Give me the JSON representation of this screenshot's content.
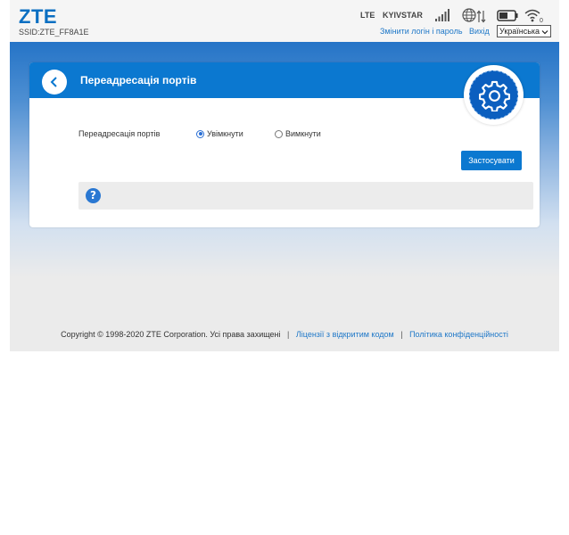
{
  "header": {
    "logo": "ZTE",
    "ssid": "SSID:ZTE_FF8A1E",
    "network_type": "LTE",
    "operator": "KYIVSTAR",
    "signal_bars": 5,
    "change_login_label": "Змінити логін і пароль",
    "logout_label": "Вихід",
    "language_selected": "Українська",
    "wifi_clients": "0"
  },
  "panel": {
    "title": "Переадресація портів",
    "field_label": "Переадресація портів",
    "option_on": "Увімкнути",
    "option_off": "Вимкнути",
    "selected": "on",
    "apply_label": "Застосувати",
    "help_symbol": "?"
  },
  "footer": {
    "copyright": "Copyright © 1998-2020 ZTE Corporation. Усі права захищені",
    "separator": "|",
    "license_link": "Ліцензії з відкритим кодом",
    "privacy_link": "Політика конфіденційності"
  },
  "colors": {
    "brand_blue": "#0a6fc2",
    "header_bar": "#0b78d0",
    "link_blue": "#1f78c8",
    "gear_circle": "#0b5fbf"
  },
  "icons": [
    "signal-icon",
    "globe-icon",
    "data-arrows-icon",
    "battery-icon",
    "wifi-icon",
    "back-arrow-icon",
    "gear-icon",
    "help-icon",
    "chevron-down-icon"
  ]
}
